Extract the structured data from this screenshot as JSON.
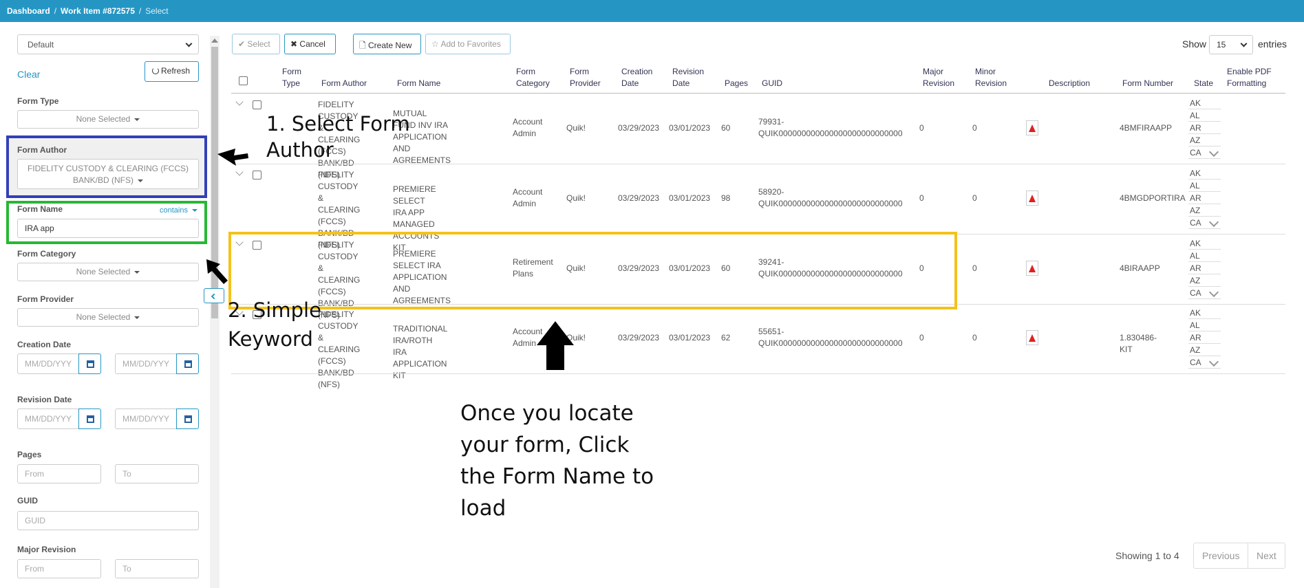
{
  "breadcrumb": {
    "dashboard": "Dashboard",
    "work_item": "Work Item #872575",
    "current": "Select"
  },
  "sidebar": {
    "preset_select": "Default",
    "clear_label": "Clear",
    "refresh_label": "Refresh",
    "form_type": {
      "label": "Form Type",
      "value": "None Selected"
    },
    "form_author": {
      "label": "Form Author",
      "value_line1": "FIDELITY CUSTODY & CLEARING (FCCS)",
      "value_line2": "BANK/BD (NFS)"
    },
    "form_name": {
      "label": "Form Name",
      "mode": "contains",
      "value": "IRA app"
    },
    "form_category": {
      "label": "Form Category",
      "value": "None Selected"
    },
    "form_provider": {
      "label": "Form Provider",
      "value": "None Selected"
    },
    "creation_date": {
      "label": "Creation Date",
      "from_placeholder": "MM/DD/YYY",
      "to_placeholder": "MM/DD/YYY"
    },
    "revision_date": {
      "label": "Revision Date",
      "from_placeholder": "MM/DD/YYY",
      "to_placeholder": "MM/DD/YYY"
    },
    "pages": {
      "label": "Pages",
      "from_placeholder": "From",
      "to_placeholder": "To"
    },
    "guid": {
      "label": "GUID",
      "placeholder": "GUID"
    },
    "major_revision": {
      "label": "Major Revision",
      "from_placeholder": "From",
      "to_placeholder": "To"
    }
  },
  "toolbar": {
    "select_label": "Select",
    "cancel_label": "Cancel",
    "create_new_label": "Create New",
    "add_favorites_label": "Add to Favorites",
    "show_label": "Show",
    "entries_value": "15",
    "entries_label": "entries"
  },
  "table": {
    "headers": {
      "form_type": [
        "Form",
        "Type"
      ],
      "form_author": "Form Author",
      "form_name": "Form Name",
      "form_category": [
        "Form",
        "Category"
      ],
      "form_provider": [
        "Form",
        "Provider"
      ],
      "creation_date": [
        "Creation",
        "Date"
      ],
      "revision_date": [
        "Revision",
        "Date"
      ],
      "pages": "Pages",
      "guid": "GUID",
      "major_revision": [
        "Major",
        "Revision"
      ],
      "minor_revision": [
        "Minor",
        "Revision"
      ],
      "description": "Description",
      "form_number": "Form Number",
      "state": "State",
      "enable_pdf": [
        "Enable PDF",
        "Formatting"
      ]
    },
    "rows": [
      {
        "author": [
          "FIDELITY",
          "CUSTODY &",
          "CLEARING",
          "(FCCS) BANK/BD",
          "(NFS)"
        ],
        "name": [
          "MUTUAL FUND INV IRA",
          "APPLICATION AND",
          "AGREEMENTS"
        ],
        "category": [
          "Account",
          "Admin"
        ],
        "provider": "Quik!",
        "creation": "03/29/2023",
        "revision": "03/01/2023",
        "pages": "60",
        "guid": [
          "79931-",
          "QUIK000000000000000000000000000"
        ],
        "major": "0",
        "minor": "0",
        "number": "4BMFIRAAPP",
        "states": [
          "AK",
          "AL",
          "AR",
          "AZ",
          "CA"
        ]
      },
      {
        "author": [
          "FIDELITY",
          "CUSTODY &",
          "CLEARING",
          "(FCCS) BANK/BD",
          "(NFS)"
        ],
        "name": [
          "PREMIERE SELECT IRA APP",
          "MANAGED ACCOUNTS KIT"
        ],
        "category": [
          "Account",
          "Admin"
        ],
        "provider": "Quik!",
        "creation": "03/29/2023",
        "revision": "03/01/2023",
        "pages": "98",
        "guid": [
          "58920-",
          "QUIK000000000000000000000000000"
        ],
        "major": "0",
        "minor": "0",
        "number": "4BMGDPORTIRA",
        "states": [
          "AK",
          "AL",
          "AR",
          "AZ",
          "CA"
        ]
      },
      {
        "author": [
          "FIDELITY",
          "CUSTODY &",
          "CLEARING",
          "(FCCS) BANK/BD",
          "(NFS)"
        ],
        "name": [
          "PREMIERE SELECT IRA",
          "APPLICATION AND",
          "AGREEMENTS"
        ],
        "category": [
          "Retirement",
          "Plans"
        ],
        "provider": "Quik!",
        "creation": "03/29/2023",
        "revision": "03/01/2023",
        "pages": "60",
        "guid": [
          "39241-",
          "QUIK000000000000000000000000000"
        ],
        "major": "0",
        "minor": "0",
        "number": "4BIRAAPP",
        "states": [
          "AK",
          "AL",
          "AR",
          "AZ",
          "CA"
        ]
      },
      {
        "author": [
          "FIDELITY",
          "CUSTODY &",
          "CLEARING",
          "(FCCS) BANK/BD",
          "(NFS)"
        ],
        "name": [
          "TRADITIONAL IRA/ROTH IRA",
          "APPLICATION KIT"
        ],
        "category": [
          "Account",
          "Admin"
        ],
        "provider": "Quik!",
        "creation": "03/29/2023",
        "revision": "03/01/2023",
        "pages": "62",
        "guid": [
          "55651-",
          "QUIK000000000000000000000000000"
        ],
        "major": "0",
        "minor": "0",
        "number": "1.830486-KIT",
        "states": [
          "AK",
          "AL",
          "AR",
          "AZ",
          "CA"
        ]
      }
    ]
  },
  "footer": {
    "showing": "Showing 1 to 4",
    "previous": "Previous",
    "next": "Next"
  },
  "annotations": {
    "step1": [
      "1. Select Form",
      "Author"
    ],
    "step2": [
      "2. Simple",
      "Keyword"
    ],
    "instruction": [
      "Once you locate",
      "your form, Click",
      "the Form Name to",
      "load"
    ]
  },
  "colors": {
    "accent": "#2596c4",
    "box_author": "#3340b8",
    "box_name": "#27b833",
    "box_row": "#f4c21a"
  }
}
